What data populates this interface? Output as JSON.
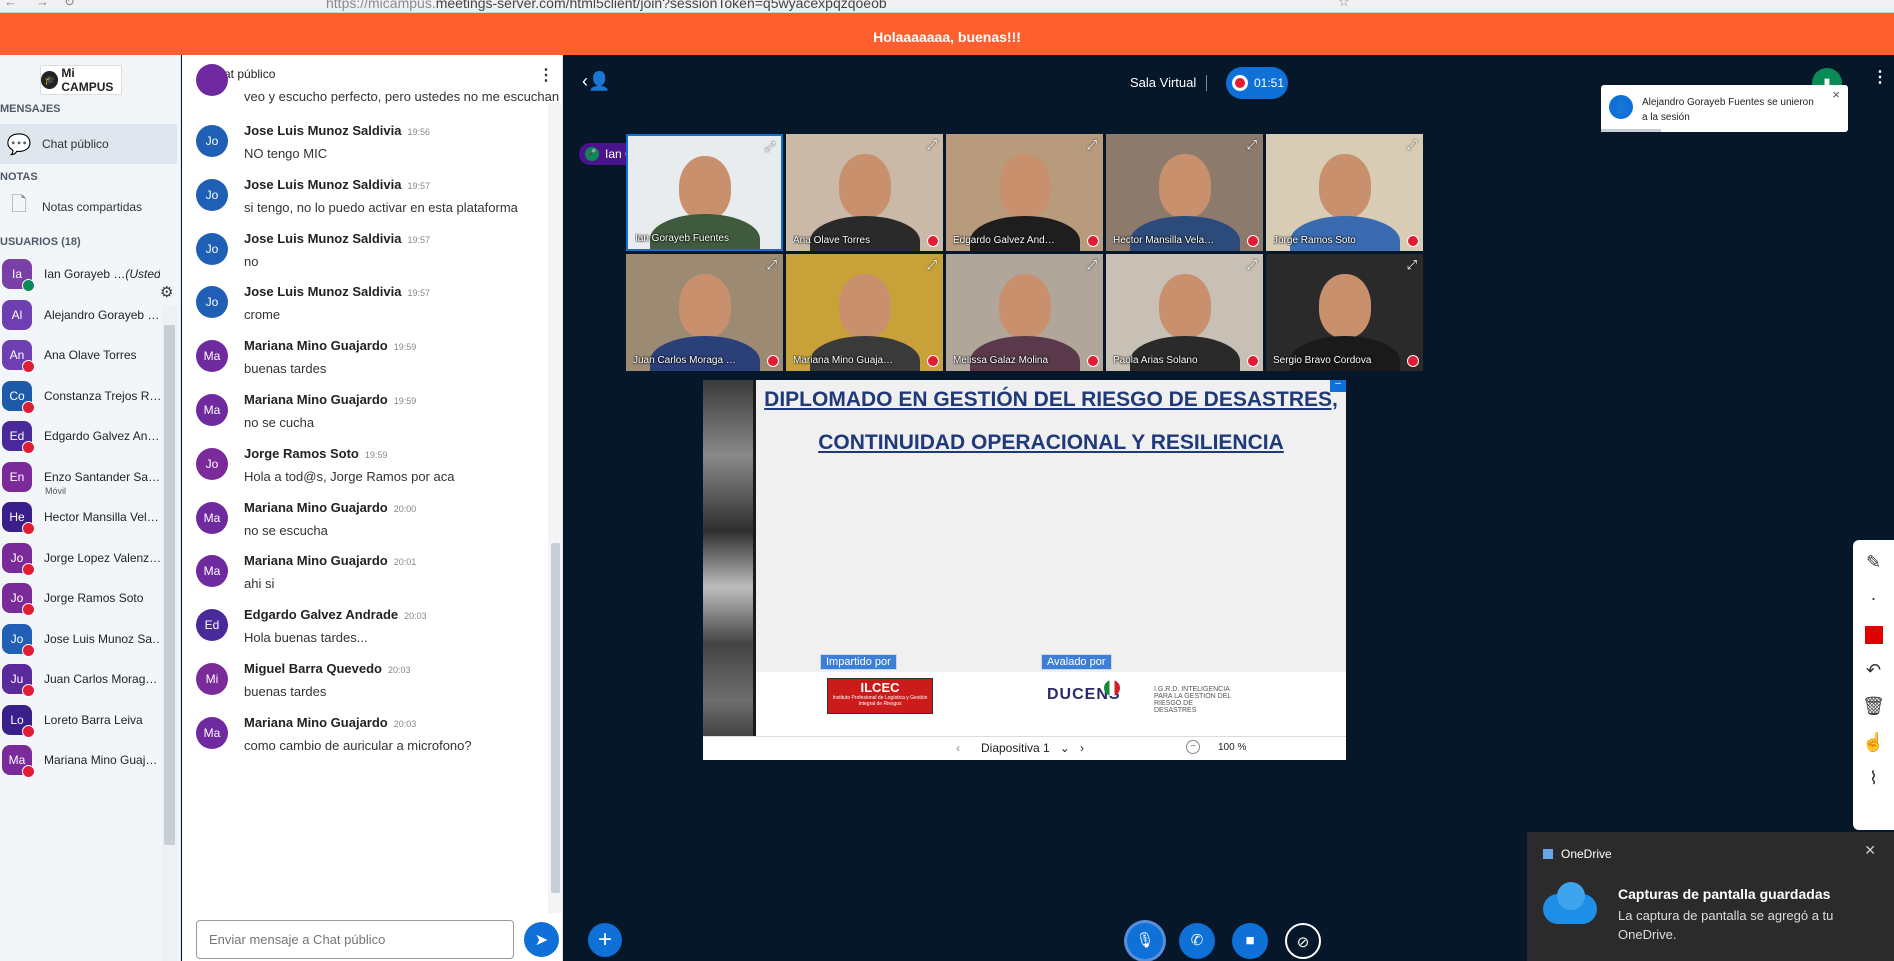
{
  "browser": {
    "url_host": "https://micampus.",
    "url_rest": "meetings-server.com/html5client/join?sessionToken=q5wyacexpqzqoeob"
  },
  "banner": {
    "text": "Holaaaaaaa, buenas!!!"
  },
  "sidebar": {
    "logo": "Mi CAMPUS",
    "messages_title": "MENSAJES",
    "public_chat": "Chat público",
    "notes_title": "NOTAS",
    "shared_notes": "Notas compartidas",
    "users_title": "USUARIOS (18)",
    "users": [
      {
        "initials": "Ia",
        "name": "Ian Gorayeb …",
        "suffix": "(Usted)",
        "color": "#7b3fa8",
        "mic": "on"
      },
      {
        "initials": "Al",
        "name": "Alejandro Gorayeb …",
        "color": "#6f3fb2",
        "mic": "none"
      },
      {
        "initials": "An",
        "name": "Ana Olave Torres",
        "color": "#6f3fb2",
        "mic": "muted"
      },
      {
        "initials": "Co",
        "name": "Constanza Trejos R…",
        "color": "#1d5ba8",
        "mic": "muted"
      },
      {
        "initials": "Ed",
        "name": "Edgardo Galvez An…",
        "color": "#4a2a9a",
        "mic": "muted"
      },
      {
        "initials": "En",
        "name": "Enzo Santander Sa…",
        "sub": "Móvil",
        "color": "#7b2a9a",
        "mic": "none"
      },
      {
        "initials": "He",
        "name": "Hector Mansilla Vel…",
        "color": "#3a1f8a",
        "mic": "muted"
      },
      {
        "initials": "Jo",
        "name": "Jorge Lopez Valenz…",
        "color": "#7b2a9a",
        "mic": "muted"
      },
      {
        "initials": "Jo",
        "name": "Jorge Ramos Soto",
        "color": "#7b2a9a",
        "mic": "muted"
      },
      {
        "initials": "Jo",
        "name": "Jose Luis Munoz Sa…",
        "color": "#1f5fb5",
        "mic": "muted"
      },
      {
        "initials": "Ju",
        "name": "Juan Carlos Morag…",
        "color": "#5a2a9a",
        "mic": "muted"
      },
      {
        "initials": "Lo",
        "name": "Loreto Barra Leiva",
        "color": "#3a1f8a",
        "mic": "muted"
      },
      {
        "initials": "Ma",
        "name": "Mariana Mino Guaj…",
        "color": "#7b2a9a",
        "mic": "muted"
      }
    ]
  },
  "chat": {
    "title": "Chat público",
    "partial_message": "veo y escucho perfecto, pero ustedes no me escuchan",
    "messages": [
      {
        "initials": "Jo",
        "color": "#1f5fb5",
        "name": "Jose Luis Munoz Saldivia",
        "time": "19:56",
        "text": "NO tengo MIC"
      },
      {
        "initials": "Jo",
        "color": "#1f5fb5",
        "name": "Jose Luis Munoz Saldivia",
        "time": "19:57",
        "text": "si tengo, no lo puedo activar en esta plataforma"
      },
      {
        "initials": "Jo",
        "color": "#1f5fb5",
        "name": "Jose Luis Munoz Saldivia",
        "time": "19:57",
        "text": "no"
      },
      {
        "initials": "Jo",
        "color": "#1f5fb5",
        "name": "Jose Luis Munoz Saldivia",
        "time": "19:57",
        "text": "crome"
      },
      {
        "initials": "Ma",
        "color": "#6f2aa0",
        "name": "Mariana Mino Guajardo",
        "time": "19:59",
        "text": "buenas tardes"
      },
      {
        "initials": "Ma",
        "color": "#6f2aa0",
        "name": "Mariana Mino Guajardo",
        "time": "19:59",
        "text": "no se cucha"
      },
      {
        "initials": "Jo",
        "color": "#7b2a9a",
        "name": "Jorge Ramos Soto",
        "time": "19:59",
        "text": "Hola a tod@s, Jorge Ramos por aca"
      },
      {
        "initials": "Ma",
        "color": "#6f2aa0",
        "name": "Mariana Mino Guajardo",
        "time": "20:00",
        "text": "no se escucha"
      },
      {
        "initials": "Ma",
        "color": "#6f2aa0",
        "name": "Mariana Mino Guajardo",
        "time": "20:01",
        "text": "ahi si"
      },
      {
        "initials": "Ed",
        "color": "#4a2a9a",
        "name": "Edgardo Galvez Andrade",
        "time": "20:03",
        "text": "Hola buenas tardes..."
      },
      {
        "initials": "Mi",
        "color": "#7b2a9a",
        "name": "Miguel Barra Quevedo",
        "time": "20:03",
        "text": "buenas tardes"
      },
      {
        "initials": "Ma",
        "color": "#6f2aa0",
        "name": "Mariana Mino Guajardo",
        "time": "20:03",
        "text": "como cambio de auricular a microfono?"
      }
    ],
    "input_placeholder": "Enviar mensaje a Chat público"
  },
  "main": {
    "room_title": "Sala Virtual",
    "recording_time": "01:51",
    "talking": "Ian Gorayeb Fuentes",
    "toast": "Alejandro Gorayeb Fuentes se unieron a la sesión",
    "videos": [
      {
        "name": "Ian Gorayeb Fuentes",
        "bg": "#e9ecef",
        "shirt": "#3f5a3c",
        "active": true
      },
      {
        "name": "Ana Olave Torres",
        "bg": "#c9b9a6",
        "shirt": "#2a2a2a"
      },
      {
        "name": "Edgardo Galvez And…",
        "bg": "#b89a7c",
        "shirt": "#1e1e1e"
      },
      {
        "name": "Hector Mansilla Vela…",
        "bg": "#8c7a6c",
        "shirt": "#2c4a7a"
      },
      {
        "name": "Jorge Ramos Soto",
        "bg": "#d8ccb4",
        "shirt": "#3a6ab0"
      },
      {
        "name": "Juan Carlos Moraga …",
        "bg": "#9c8a72",
        "shirt": "#2b3f78"
      },
      {
        "name": "Mariana Mino Guaja…",
        "bg": "#c8a238",
        "shirt": "#3a3a3a"
      },
      {
        "name": "Melissa Galaz Molina",
        "bg": "#b0a69a",
        "shirt": "#5a3a4a"
      },
      {
        "name": "Paola Arias Solano",
        "bg": "#c8c0b4",
        "shirt": "#2a2a2a"
      },
      {
        "name": "Sergio Bravo Cordova",
        "bg": "#2a2a2a",
        "shirt": "#1a1a1a"
      }
    ],
    "slide": {
      "title_line1": "DIPLOMADO EN GESTIÓN DEL RIESGO DE DESASTRES,",
      "title_line2": "CONTINUIDAD OPERACIONAL Y RESILIENCIA",
      "label_left": "Impartido por",
      "label_right": "Avalado por",
      "logo1": "ILCEC",
      "logo1_sub": "Instituto Profesional de Logística y Gestión Integral de Riesgos",
      "logo2": "DUCENS",
      "logo3": "I.G.R.D. INTELIGENCIA PARA LA GESTIÓN DEL RIESGO DE DESASTRES",
      "slide_name": "Diapositiva 1",
      "zoom": "100 %"
    }
  },
  "onedrive": {
    "app": "OneDrive",
    "title": "Capturas de pantalla guardadas",
    "body": "La captura de pantalla se agregó a tu OneDrive."
  }
}
